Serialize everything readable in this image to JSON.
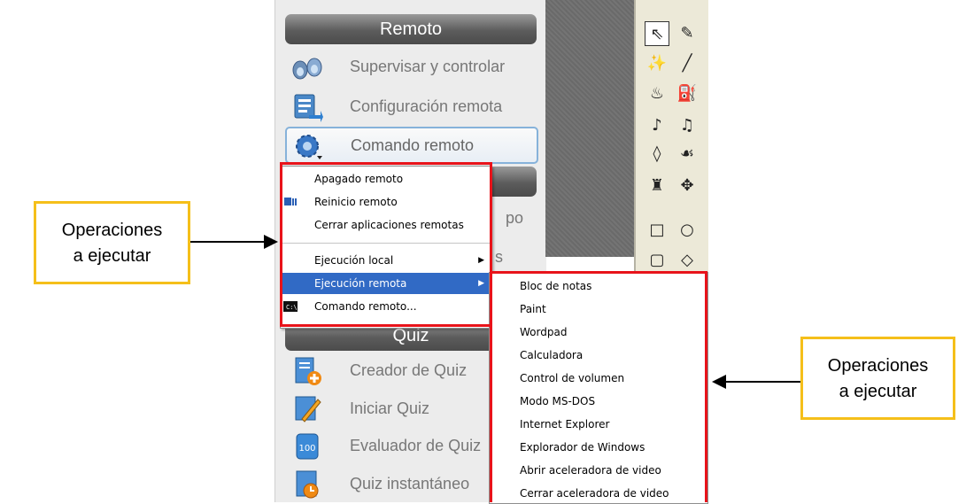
{
  "panel": {
    "remote_header": "Remoto",
    "quiz_header": "Quiz",
    "remote_items": [
      {
        "label": "Supervisar y controlar",
        "icon": "binoculars-icon"
      },
      {
        "label": "Configuración remota",
        "icon": "remote-config-icon"
      },
      {
        "label": "Comando remoto",
        "icon": "gear-command-icon"
      }
    ],
    "partial_items": [
      {
        "label": "po"
      },
      {
        "label": "s"
      }
    ],
    "quiz_items": [
      {
        "label": "Creador de Quiz",
        "icon": "quiz-creator-icon"
      },
      {
        "label": "Iniciar Quiz",
        "icon": "start-quiz-icon"
      },
      {
        "label": "Evaluador de Quiz",
        "icon": "quiz-evaluator-icon"
      },
      {
        "label": "Quiz instantáneo",
        "icon": "instant-quiz-icon"
      }
    ]
  },
  "context_menu": {
    "items": [
      {
        "label": "Apagado remoto",
        "accel": "A"
      },
      {
        "label": "Reinicio remoto",
        "accel": "R"
      },
      {
        "label": "Cerrar aplicaciones remotas",
        "accel": "C"
      },
      {
        "label": "Ejecución local",
        "accel": "E"
      },
      {
        "label": "Ejecución remota",
        "accel": "r"
      },
      {
        "label": "Comando remoto...",
        "accel": "o"
      }
    ]
  },
  "submenu": {
    "items": [
      "Bloc de notas",
      "Paint",
      "Wordpad",
      "Calculadora",
      "Control de volumen",
      "Modo MS-DOS",
      "Internet Explorer",
      "Explorador de Windows",
      "Abrir aceleradora de video",
      "Cerrar aceleradora de video"
    ]
  },
  "annotations": {
    "left_line1": "Operaciones",
    "left_line2": "a ejecutar",
    "right_line1": "Operaciones",
    "right_line2": "a ejecutar"
  },
  "colors": {
    "highlight": "#316ac5",
    "annotation_red": "#e8131a",
    "callout_border": "#f5bf1a"
  }
}
